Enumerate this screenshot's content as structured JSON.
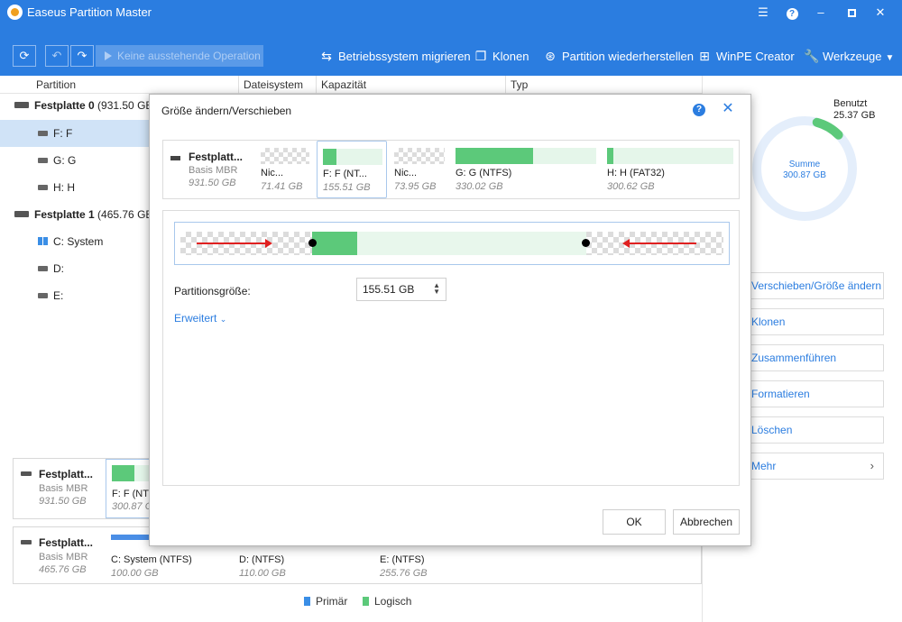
{
  "window": {
    "title": "Easeus Partition Master"
  },
  "toolbar": {
    "pending_label": "Keine ausstehende Operation",
    "actions": [
      {
        "label": "Betriebssystem migrieren"
      },
      {
        "label": "Klonen"
      },
      {
        "label": "Partition wiederherstellen"
      },
      {
        "label": "WinPE Creator"
      },
      {
        "label": "Werkzeuge"
      }
    ]
  },
  "columns": {
    "partition": "Partition",
    "filesystem": "Dateisystem",
    "capacity": "Kapazität",
    "type": "Typ"
  },
  "tree": {
    "disk0_name": "Festplatte 0",
    "disk0_size": "(931.50 GB",
    "disk0_parts": [
      "F: F",
      "G: G",
      "H: H"
    ],
    "disk1_name": "Festplatte 1",
    "disk1_size": "(465.76 GB",
    "disk1_parts": [
      "C: System",
      "D:",
      "E:"
    ]
  },
  "bottom_disks": {
    "disk0": {
      "name": "Festplatt...",
      "type": "Basis MBR",
      "size": "931.50 GB",
      "part_label": "F: F (NTFS",
      "part_size": "300.87 G",
      "part_used_fraction": 0.55
    },
    "disk1": {
      "name": "Festplatt...",
      "type": "Basis MBR",
      "size": "465.76 GB",
      "parts": [
        {
          "label": "C: System (NTFS)",
          "size": "100.00 GB",
          "used_fraction": 1.0,
          "color": "#4a8ee6"
        },
        {
          "label": "D:  (NTFS)",
          "size": "110.00 GB",
          "used_fraction": 0.05,
          "color": "#5cc97a"
        },
        {
          "label": "E:  (NTFS)",
          "size": "255.76 GB",
          "used_fraction": 1.0,
          "color": "#5cc97a"
        }
      ]
    }
  },
  "legend": {
    "primary": "Primär",
    "logical": "Logisch",
    "primary_color": "#3a8ee6",
    "logical_color": "#5cc97a"
  },
  "summary": {
    "used_title": "Benutzt",
    "used_value": "25.37 GB",
    "sum_title": "Summe",
    "sum_value": "300.87 GB",
    "used_fraction": 0.084
  },
  "right_actions": [
    {
      "label": "Verschieben/Größe ändern"
    },
    {
      "label": "Klonen"
    },
    {
      "label": "Zusammenführen"
    },
    {
      "label": "Formatieren"
    },
    {
      "label": "Löschen"
    },
    {
      "label": "Mehr"
    }
  ],
  "dialog": {
    "title": "Größe ändern/Verschieben",
    "help": "?",
    "strip_disk": {
      "name": "Festplatt...",
      "type": "Basis MBR",
      "size": "931.50 GB"
    },
    "strip_parts": [
      {
        "label": "Nic...",
        "size": "71.41 GB",
        "unallocated": true,
        "used_fraction": 0
      },
      {
        "label": "F: F (NT...",
        "size": "155.51 GB",
        "unallocated": false,
        "used_fraction": 0.22,
        "selected": true
      },
      {
        "label": "Nic...",
        "size": "73.95 GB",
        "unallocated": true,
        "used_fraction": 0
      },
      {
        "label": "G: G (NTFS)",
        "size": "330.02 GB",
        "unallocated": false,
        "used_fraction": 0.55
      },
      {
        "label": "H: H (FAT32)",
        "size": "300.62 GB",
        "unallocated": false,
        "used_fraction": 0.05
      }
    ],
    "partition_size_label": "Partitionsgröße:",
    "partition_size_value": "155.51 GB",
    "advanced_label": "Erweitert",
    "ok_label": "OK",
    "cancel_label": "Abbrechen"
  }
}
